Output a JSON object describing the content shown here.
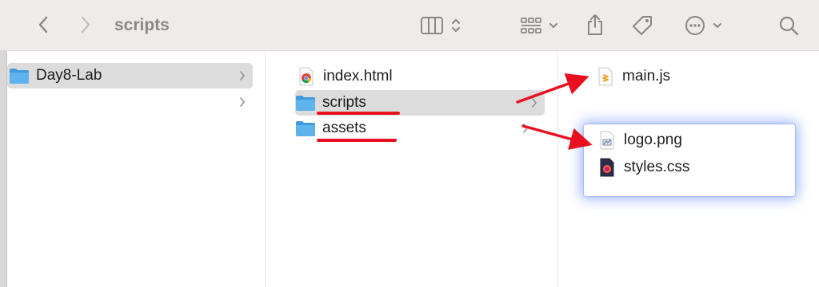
{
  "toolbar": {
    "title": "scripts",
    "icons": [
      "chevron-left-icon",
      "chevron-right-icon",
      "column-view-icon",
      "up-down-chevron-icon",
      "grid-view-icon",
      "chevron-down-icon",
      "share-icon",
      "tag-icon",
      "more-icon",
      "chevron-down-icon",
      "search-icon"
    ]
  },
  "column1": {
    "items": [
      {
        "label": "Day8-Lab",
        "icon": "folder-icon",
        "selected": true
      }
    ]
  },
  "column2": {
    "items": [
      {
        "label": "index.html",
        "icon": "chrome-html-file-icon"
      },
      {
        "label": "scripts",
        "icon": "folder-icon",
        "selected": true
      },
      {
        "label": "assets",
        "icon": "folder-icon"
      }
    ]
  },
  "column3": {
    "items": [
      {
        "label": "main.js",
        "icon": "javascript-file-icon"
      }
    ]
  },
  "popup": {
    "items": [
      {
        "label": "logo.png",
        "icon": "image-file-icon"
      },
      {
        "label": "styles.css",
        "icon": "css-file-icon"
      }
    ]
  },
  "colors": {
    "annotation": "#e8101f",
    "folder": "#4ea9e6",
    "selection": "#dcdcdc",
    "popup_glow": "#5a82ff"
  }
}
